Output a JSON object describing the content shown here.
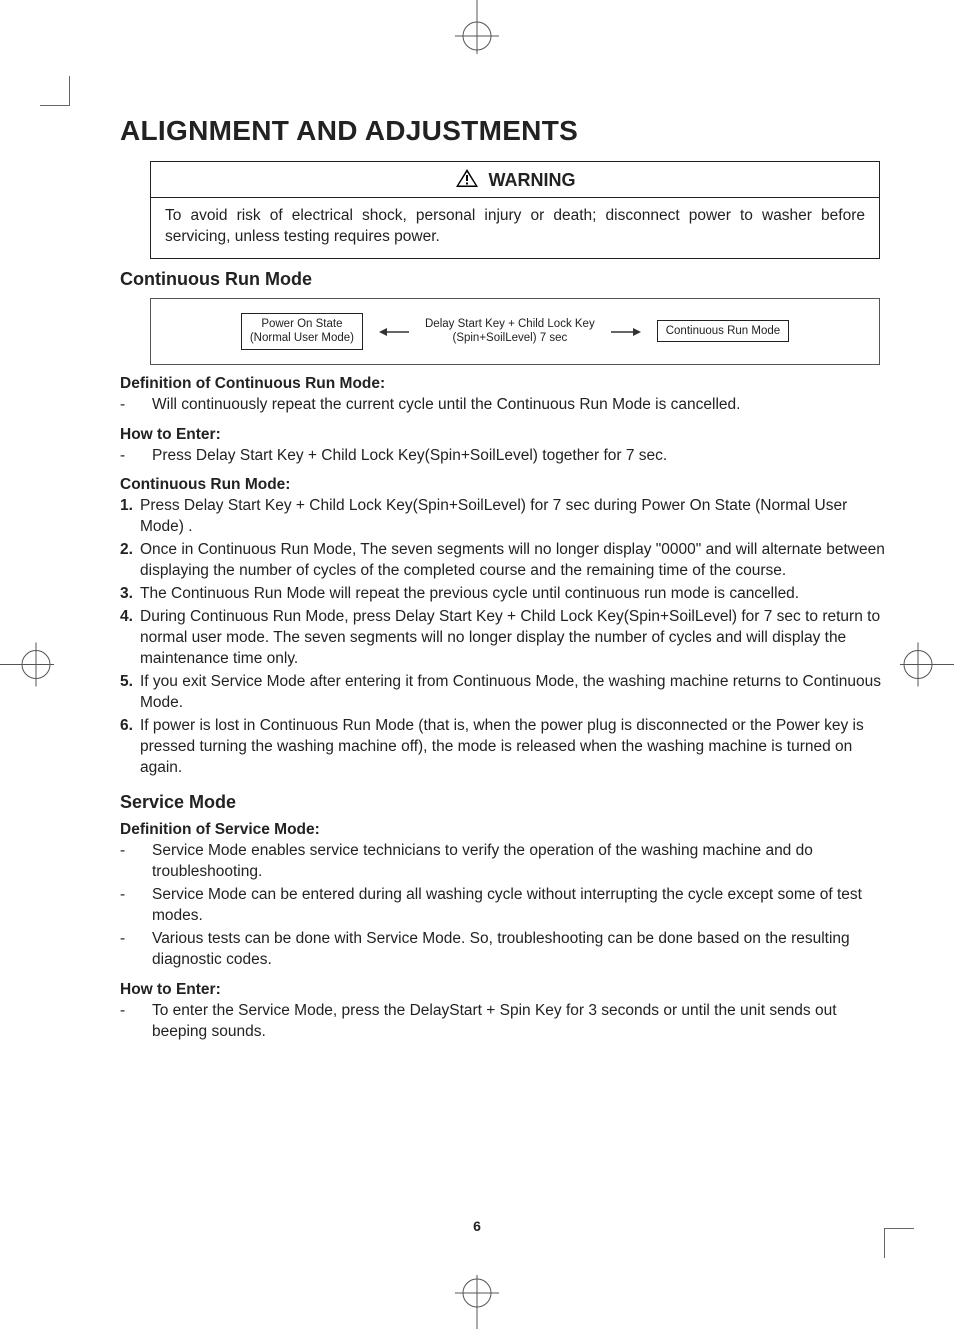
{
  "page": {
    "title": "ALIGNMENT AND ADJUSTMENTS",
    "number": "6"
  },
  "warning": {
    "label": "WARNING",
    "text": "To avoid risk of electrical shock, personal injury or death; disconnect power to washer before servicing, unless testing requires power."
  },
  "continuous": {
    "heading": "Continuous Run Mode",
    "flow": {
      "box1_line1": "Power On State",
      "box1_line2": "(Normal User Mode)",
      "box2_line1": "Delay Start Key + Child Lock Key",
      "box2_line2": "(Spin+SoilLevel) 7 sec",
      "box3": "Continuous Run Mode"
    },
    "definition_label": "Definition of Continuous Run Mode:",
    "definition_item": "Will continuously repeat the current cycle until the Continuous Run Mode is cancelled.",
    "how_label": "How to Enter:",
    "how_item": "Press Delay Start Key + Child Lock Key(Spin+SoilLevel) together for 7 sec.",
    "steps_label": "Continuous Run Mode:",
    "steps": [
      "Press Delay Start Key + Child Lock Key(Spin+SoilLevel) for 7 sec during Power On State (Normal User Mode) .",
      "Once in Continuous Run Mode, The seven segments will no longer display \"0000\" and will alternate between displaying the number of cycles of the completed course and the remaining time of the course.",
      "The Continuous Run Mode will repeat the previous cycle until continuous run mode is cancelled.",
      "During Continuous Run Mode, press Delay Start Key + Child Lock Key(Spin+SoilLevel) for 7 sec to return to normal user mode. The seven segments will no longer display the number of cycles and will display the maintenance time only.",
      "If you exit Service Mode after entering it from Continuous Mode, the washing machine returns to Continuous Mode.",
      "If power is lost in Continuous Run Mode (that is, when the power plug is disconnected or the Power key is pressed turning the washing machine off), the mode is released when the washing machine is turned on again."
    ]
  },
  "service": {
    "heading": "Service Mode",
    "definition_label": "Definition of Service Mode:",
    "definition_items": [
      "Service Mode enables service technicians to verify the operation of the washing machine and do troubleshooting.",
      "Service Mode can be entered during all washing cycle without interrupting the cycle except some of test modes.",
      "Various tests can be done with Service Mode. So, troubleshooting can be done based on the resulting diagnostic codes."
    ],
    "how_label": "How to Enter:",
    "how_item": "To enter the Service Mode, press the DelayStart + Spin Key for 3 seconds or until the unit sends out beeping sounds."
  }
}
